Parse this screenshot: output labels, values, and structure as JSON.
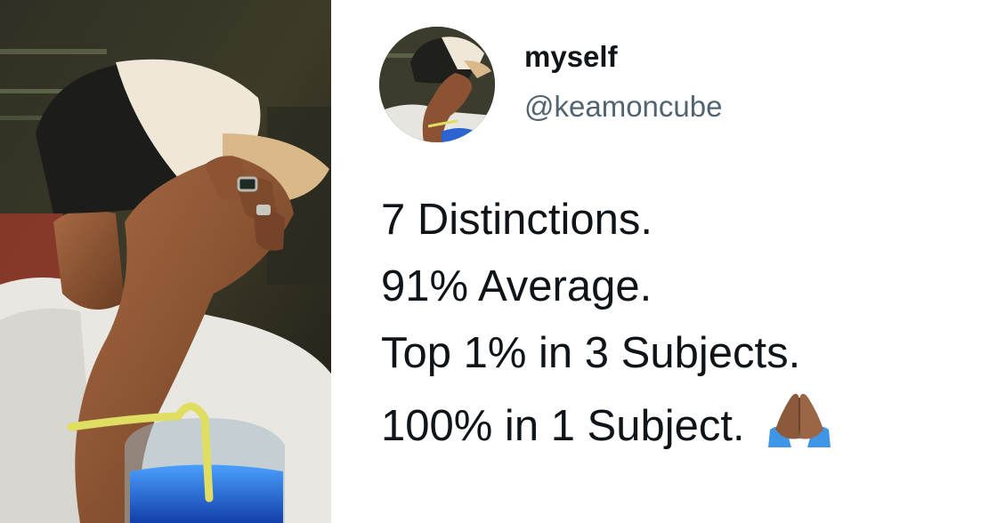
{
  "photo": {
    "icon": "selfie-photo"
  },
  "tweet": {
    "author": {
      "display_name": "myself",
      "handle": "@keamoncube",
      "avatar_icon": "profile-avatar"
    },
    "lines": [
      "7 Distinctions.",
      "91% Average.",
      "Top 1% in 3 Subjects.",
      "100% in 1 Subject."
    ],
    "emoji": "folded-hands-medium-dark-skin-tone"
  },
  "colors": {
    "text_primary": "#0f1419",
    "text_secondary": "#536471",
    "background": "#ffffff"
  }
}
